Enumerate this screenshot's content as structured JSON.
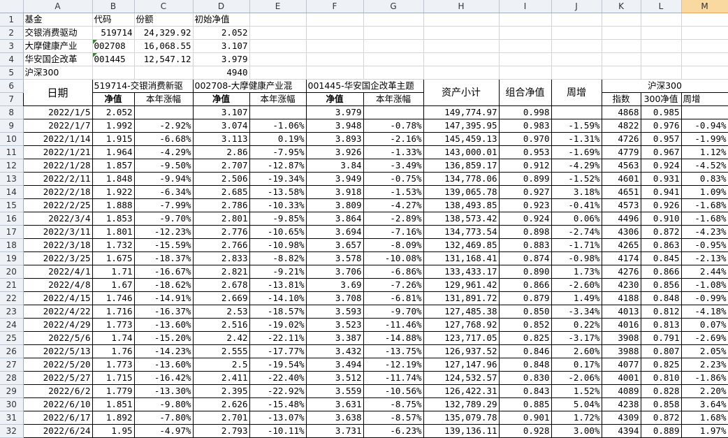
{
  "sheet": {
    "columns": [
      "A",
      "B",
      "C",
      "D",
      "E",
      "F",
      "G",
      "H",
      "I",
      "J",
      "K",
      "L",
      "M"
    ],
    "row_numbers": [
      "1",
      "2",
      "3",
      "4",
      "5",
      "6",
      "7",
      "8",
      "9",
      "10",
      "11",
      "12",
      "13",
      "14",
      "15",
      "16",
      "17",
      "18",
      "19",
      "20",
      "21",
      "22",
      "23",
      "24",
      "25",
      "26",
      "27",
      "28",
      "29",
      "30",
      "31",
      "32"
    ],
    "top": {
      "labels": [
        "基金",
        "代码",
        "份额",
        "初始净值"
      ],
      "funds": [
        {
          "name": "交银消费驱动",
          "code": "519714",
          "shares": "24,329.92",
          "nav": "2.052"
        },
        {
          "name": "大摩健康产业",
          "code": "002708",
          "shares": "16,068.55",
          "nav": "3.107"
        },
        {
          "name": "华安国企改革",
          "code": "001445",
          "shares": "12,547.12",
          "nav": "3.979"
        }
      ],
      "index_name": "沪深300",
      "index_value": "4940"
    },
    "header": {
      "date": "日期",
      "fund1": "519714-交银消费新驱",
      "fund2": "002708-大摩健康产业混",
      "fund3": "001445-华安国企改革主题",
      "nav": "净值",
      "ytd": "本年涨幅",
      "asset_total": "资产小计",
      "portfolio_nav": "组合净值",
      "weekly": "周增",
      "index_group": "沪深300",
      "index": "指数",
      "index_nav": "300净值",
      "index_weekly": "周增"
    },
    "rows": [
      [
        "2022/1/5",
        "2.052",
        "",
        "3.107",
        "",
        "3.979",
        "",
        "149,774.97",
        "0.998",
        "",
        "4868",
        "0.985",
        ""
      ],
      [
        "2022/1/7",
        "1.992",
        "-2.92%",
        "3.074",
        "-1.06%",
        "3.948",
        "-0.78%",
        "147,395.95",
        "0.983",
        "-1.59%",
        "4822",
        "0.976",
        "-0.94%"
      ],
      [
        "2022/1/14",
        "1.915",
        "-6.68%",
        "3.113",
        "0.19%",
        "3.893",
        "-2.16%",
        "145,459.13",
        "0.970",
        "-1.31%",
        "4726",
        "0.957",
        "-1.99%"
      ],
      [
        "2022/1/21",
        "1.964",
        "-4.29%",
        "2.86",
        "-7.95%",
        "3.926",
        "-1.33%",
        "143,000.01",
        "0.953",
        "-1.69%",
        "4779",
        "0.967",
        "1.12%"
      ],
      [
        "2022/1/28",
        "1.857",
        "-9.50%",
        "2.707",
        "-12.87%",
        "3.84",
        "-3.49%",
        "136,859.17",
        "0.912",
        "-4.29%",
        "4563",
        "0.924",
        "-4.52%"
      ],
      [
        "2022/2/11",
        "1.848",
        "-9.94%",
        "2.506",
        "-19.34%",
        "3.949",
        "-0.75%",
        "134,778.06",
        "0.899",
        "-1.52%",
        "4601",
        "0.931",
        "0.83%"
      ],
      [
        "2022/2/18",
        "1.922",
        "-6.34%",
        "2.685",
        "-13.58%",
        "3.918",
        "-1.53%",
        "139,065.78",
        "0.927",
        "3.18%",
        "4651",
        "0.941",
        "1.09%"
      ],
      [
        "2022/2/25",
        "1.888",
        "-7.99%",
        "2.786",
        "-10.33%",
        "3.809",
        "-4.27%",
        "138,493.85",
        "0.923",
        "-0.41%",
        "4573",
        "0.926",
        "-1.68%"
      ],
      [
        "2022/3/4",
        "1.853",
        "-9.70%",
        "2.801",
        "-9.85%",
        "3.864",
        "-2.89%",
        "138,573.42",
        "0.924",
        "0.06%",
        "4496",
        "0.910",
        "-1.68%"
      ],
      [
        "2022/3/11",
        "1.801",
        "-12.23%",
        "2.776",
        "-10.65%",
        "3.694",
        "-7.16%",
        "134,773.54",
        "0.898",
        "-2.74%",
        "4306",
        "0.872",
        "-4.23%"
      ],
      [
        "2022/3/18",
        "1.732",
        "-15.59%",
        "2.766",
        "-10.98%",
        "3.657",
        "-8.09%",
        "132,469.85",
        "0.883",
        "-1.71%",
        "4265",
        "0.863",
        "-0.95%"
      ],
      [
        "2022/3/25",
        "1.675",
        "-18.37%",
        "2.833",
        "-8.82%",
        "3.578",
        "-10.08%",
        "131,168.41",
        "0.874",
        "-0.98%",
        "4174",
        "0.845",
        "-2.13%"
      ],
      [
        "2022/4/1",
        "1.71",
        "-16.67%",
        "2.821",
        "-9.21%",
        "3.706",
        "-6.86%",
        "133,433.17",
        "0.890",
        "1.73%",
        "4276",
        "0.866",
        "2.44%"
      ],
      [
        "2022/4/8",
        "1.67",
        "-18.62%",
        "2.678",
        "-13.81%",
        "3.69",
        "-7.26%",
        "129,961.42",
        "0.866",
        "-2.60%",
        "4230",
        "0.856",
        "-1.08%"
      ],
      [
        "2022/4/15",
        "1.746",
        "-14.91%",
        "2.669",
        "-14.10%",
        "3.708",
        "-6.81%",
        "131,891.72",
        "0.879",
        "1.49%",
        "4188",
        "0.848",
        "-0.99%"
      ],
      [
        "2022/4/22",
        "1.716",
        "-16.37%",
        "2.53",
        "-18.57%",
        "3.593",
        "-9.70%",
        "127,485.38",
        "0.850",
        "-3.34%",
        "4013",
        "0.812",
        "-4.18%"
      ],
      [
        "2022/4/29",
        "1.773",
        "-13.60%",
        "2.516",
        "-19.02%",
        "3.523",
        "-11.46%",
        "127,768.92",
        "0.852",
        "0.22%",
        "4016",
        "0.813",
        "0.07%"
      ],
      [
        "2022/5/6",
        "1.74",
        "-15.20%",
        "2.42",
        "-22.11%",
        "3.387",
        "-14.88%",
        "123,717.05",
        "0.825",
        "-3.17%",
        "3908",
        "0.791",
        "-2.69%"
      ],
      [
        "2022/5/13",
        "1.76",
        "-14.23%",
        "2.555",
        "-17.77%",
        "3.432",
        "-13.75%",
        "126,937.52",
        "0.846",
        "2.60%",
        "3988",
        "0.807",
        "2.05%"
      ],
      [
        "2022/5/20",
        "1.773",
        "-13.60%",
        "2.5",
        "-19.54%",
        "3.494",
        "-12.19%",
        "127,147.96",
        "0.848",
        "0.17%",
        "4077",
        "0.825",
        "2.23%"
      ],
      [
        "2022/5/27",
        "1.715",
        "-16.42%",
        "2.411",
        "-22.40%",
        "3.512",
        "-11.74%",
        "124,532.57",
        "0.830",
        "-2.06%",
        "4001",
        "0.810",
        "-1.86%"
      ],
      [
        "2022/6/2",
        "1.779",
        "-13.30%",
        "2.395",
        "-22.92%",
        "3.559",
        "-10.56%",
        "126,422.31",
        "0.843",
        "1.52%",
        "4089",
        "0.828",
        "2.20%"
      ],
      [
        "2022/6/10",
        "1.851",
        "-9.80%",
        "2.626",
        "-15.48%",
        "3.631",
        "-8.75%",
        "132,789.29",
        "0.885",
        "5.04%",
        "4238",
        "0.858",
        "3.64%"
      ],
      [
        "2022/6/17",
        "1.892",
        "-7.80%",
        "2.701",
        "-13.07%",
        "3.638",
        "-8.57%",
        "135,079.78",
        "0.901",
        "1.72%",
        "4309",
        "0.872",
        "1.68%"
      ],
      [
        "2022/6/24",
        "1.95",
        "-4.97%",
        "2.793",
        "-10.11%",
        "3.731",
        "-6.23%",
        "139,136.11",
        "0.928",
        "3.00%",
        "4394",
        "0.889",
        "1.97%"
      ]
    ],
    "colors": {
      "header_bg": "#eef1f6",
      "selected_col_bg": "#f9d99f",
      "grid": "#d4d4d4",
      "warning_triangle": "#2c8a2c"
    }
  }
}
